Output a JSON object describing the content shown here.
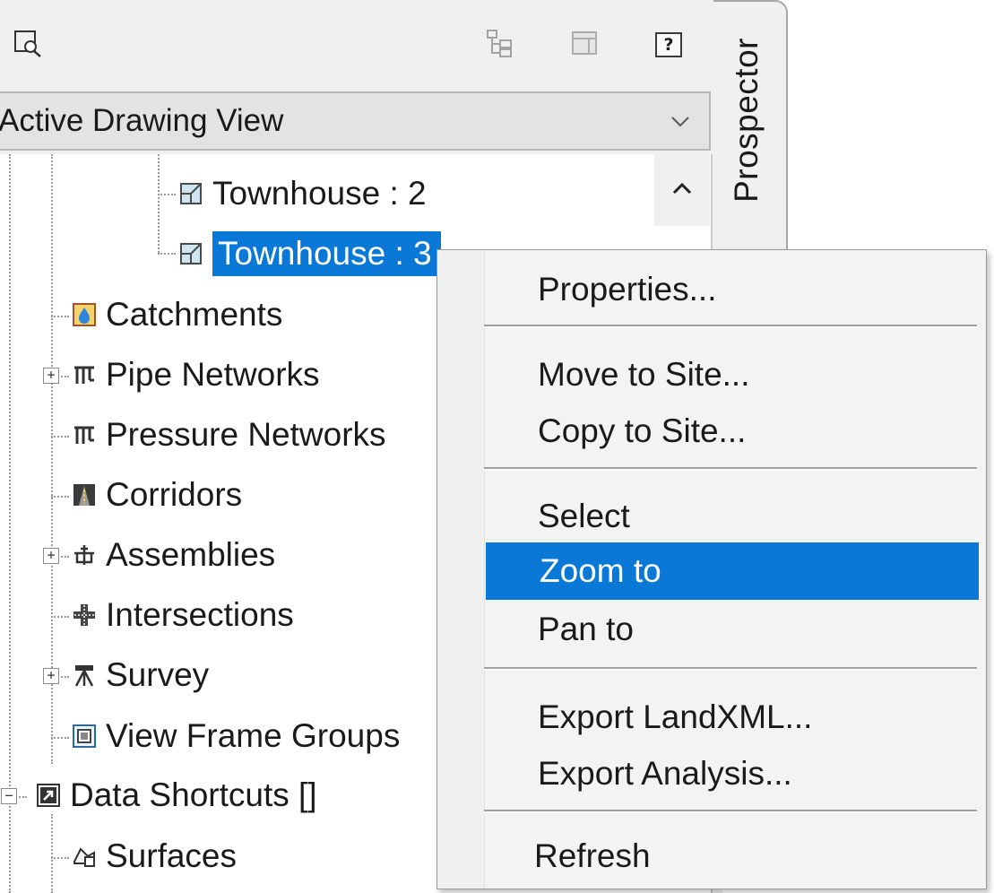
{
  "toolbar": {
    "icons": [
      "zoom-preview-icon",
      "hierarchy-icon",
      "table-view-icon",
      "help-icon"
    ],
    "help_label": "?"
  },
  "view_selector": {
    "value": "Active Drawing View"
  },
  "side_tab": {
    "label": "Prospector"
  },
  "tree": {
    "nodes": [
      {
        "label": "Townhouse : 2",
        "icon": "parcel-icon",
        "selected": false
      },
      {
        "label": "Townhouse : 3",
        "icon": "parcel-icon",
        "selected": true
      },
      {
        "label": "Catchments",
        "icon": "catchment-icon",
        "expander": null
      },
      {
        "label": "Pipe Networks",
        "icon": "pipe-network-icon",
        "expander": "+"
      },
      {
        "label": "Pressure Networks",
        "icon": "pressure-network-icon",
        "expander": null
      },
      {
        "label": "Corridors",
        "icon": "corridor-icon",
        "expander": null
      },
      {
        "label": "Assemblies",
        "icon": "assembly-icon",
        "expander": "+"
      },
      {
        "label": "Intersections",
        "icon": "intersection-icon",
        "expander": null
      },
      {
        "label": "Survey",
        "icon": "survey-icon",
        "expander": "+"
      },
      {
        "label": "View Frame Groups",
        "icon": "view-frame-icon",
        "expander": null
      },
      {
        "label": "Data Shortcuts []",
        "icon": "shortcut-icon",
        "expander": "−"
      },
      {
        "label": "Surfaces",
        "icon": "surface-icon",
        "expander": null
      }
    ]
  },
  "context_menu": {
    "items": [
      {
        "label": "Properties...",
        "highlighted": false
      },
      {
        "label": "Move to Site...",
        "highlighted": false
      },
      {
        "label": "Copy to Site...",
        "highlighted": false
      },
      {
        "label": "Select",
        "highlighted": false
      },
      {
        "label": "Zoom to",
        "highlighted": true
      },
      {
        "label": "Pan to",
        "highlighted": false
      },
      {
        "label": "Export LandXML...",
        "highlighted": false
      },
      {
        "label": "Export Analysis...",
        "highlighted": false
      },
      {
        "label": "Refresh",
        "highlighted": false
      }
    ]
  },
  "colors": {
    "selection": "#0a78d7",
    "panel": "#f0f0f0",
    "menu": "#f3f3f3"
  }
}
